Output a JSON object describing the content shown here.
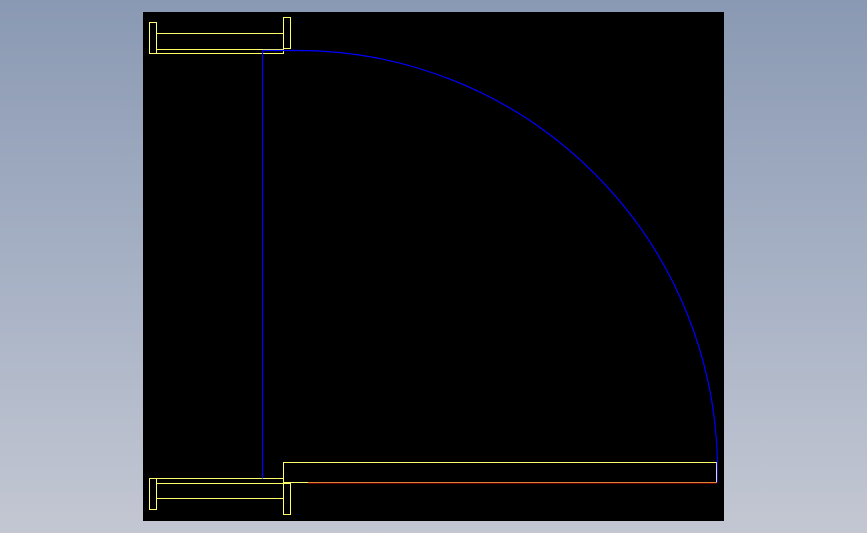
{
  "colors": {
    "background_top": "#8a99b3",
    "background_bottom": "#c3c7d2",
    "viewport": "#000000",
    "flange_outline": "#ffff66",
    "elbow_outline": "#0000ff",
    "edge_line": "#c00000"
  }
}
